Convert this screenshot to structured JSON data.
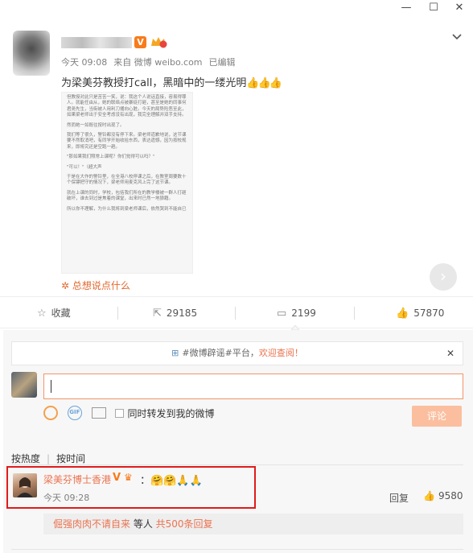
{
  "window": {
    "minimize_glyph": "—",
    "maximize_glyph": "☐",
    "close_glyph": "✕"
  },
  "post": {
    "meta_time": "今天 09:08",
    "meta_source": "来自 微博 weibo.com",
    "meta_edited": "已编辑",
    "text": "为梁美芬教授打call，黑暗中的一缕光明",
    "thumbs": "👍👍👍",
    "document_paragraphs": [
      "但教授对此只是苦苦一笑，说：我这个人说话直接，容易得罪人。就能任由从，她的联络点被暴徒打砸，甚至是她的同事何君尧先生，当街被人用利刀捅向心脏。今天的局势险恶至此，如果梁老师出于安全考虑没有出现，我完全理解并双手支持。",
      "然而她一如既往按时出现了。",
      "我们等了很久，警铃都没有停下来。梁老师道歉地说，这节课要不然取消吧，有同学开始收拾东西，表达遗憾，因为按校规来，即将究还是空跑一趟。",
      "\"那如果我们照常上课呢？你们觉得可以吗？\"",
      "\"可以！\"（超大声",
      "于是在大作的警铃里，在全港八校停课之后，在教室周要数十个保镖把守的情况下，梁老师用麦克风上完了这节课。",
      "就在上课的同时，学校，包括我们所在的教学楼被一群人打砸破坏，谁去到过是焦着的课堂，出来时已然一地狼藉。",
      "所以你不理解，为什么我将到梁老师课后，依然哭到不能自已"
    ],
    "comment_prompt": "总想说点什么"
  },
  "actions": {
    "favorite_label": "收藏",
    "repost_count": "29185",
    "comment_count": "2199",
    "like_count": "57870"
  },
  "comments_panel": {
    "notice_tag": "#微博辟谣#平台，",
    "notice_link": "欢迎查阅！",
    "input_value": "",
    "gif_label": "GIF",
    "repost_checkbox_label": "同时转发到我的微博",
    "submit_label": "评论",
    "sort_hot": "按热度",
    "sort_time": "按时间"
  },
  "top_comment": {
    "author": "梁美芬博士香港",
    "v_badge": "V",
    "crown": "♛",
    "text_prefix": "：",
    "emojis": "🤗🤗🙏🙏",
    "time": "今天 09:28",
    "reply_label": "回复",
    "likes": "9580",
    "sub_reply_user": "倔强肉肉不请自来",
    "sub_reply_mid": " 等人 ",
    "sub_reply_count": "共500条回复"
  },
  "colors": {
    "accent_orange": "#eb7350",
    "highlight_red": "#e01b1b",
    "submit_disabled": "#fbbf9f"
  }
}
